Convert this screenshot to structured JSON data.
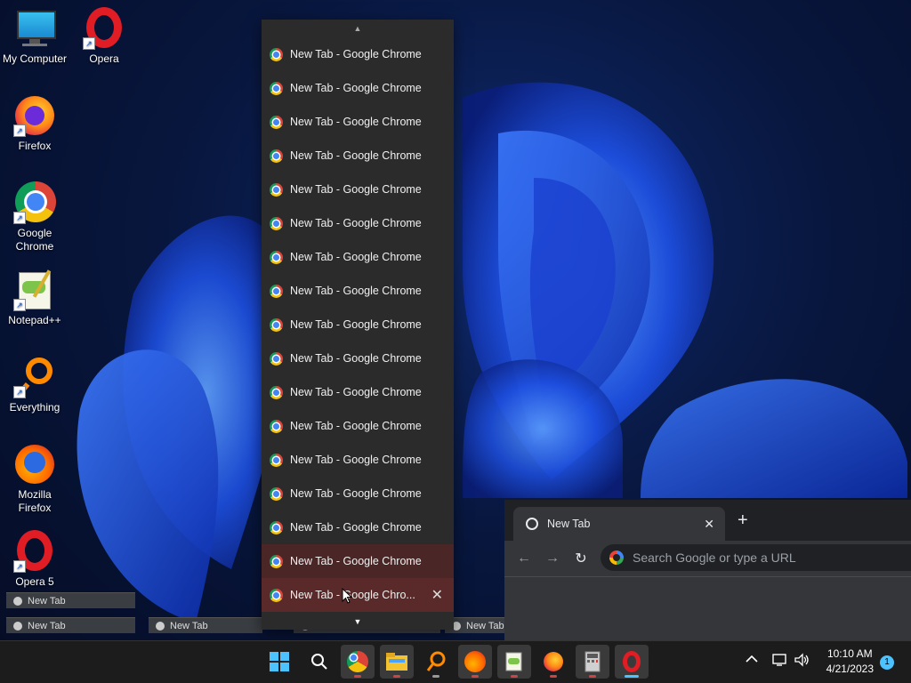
{
  "desktop": {
    "icons": [
      {
        "label": "My Computer"
      },
      {
        "label": "Opera"
      },
      {
        "label": "Firefox"
      },
      {
        "label": "Google Chrome"
      },
      {
        "label": "Notepad++"
      },
      {
        "label": "Everything"
      },
      {
        "label": "Mozilla Firefox"
      },
      {
        "label": "Opera 5"
      }
    ]
  },
  "thumbnails": [
    {
      "label": "New Tab"
    },
    {
      "label": "New Tab"
    },
    {
      "label": "New Tab"
    },
    {
      "label": "New Tab"
    },
    {
      "label": "New Tab"
    }
  ],
  "jumplist": {
    "items": [
      "New Tab - Google Chrome",
      "New Tab - Google Chrome",
      "New Tab - Google Chrome",
      "New Tab - Google Chrome",
      "New Tab - Google Chrome",
      "New Tab - Google Chrome",
      "New Tab - Google Chrome",
      "New Tab - Google Chrome",
      "New Tab - Google Chrome",
      "New Tab - Google Chrome",
      "New Tab - Google Chrome",
      "New Tab - Google Chrome",
      "New Tab - Google Chrome",
      "New Tab - Google Chrome",
      "New Tab - Google Chrome",
      "New Tab - Google Chrome"
    ],
    "hovered_item": "New Tab - Google Chro...",
    "close_glyph": "✕",
    "scroll_up_glyph": "▲",
    "scroll_down_glyph": "▼"
  },
  "chrome": {
    "tab_title": "New Tab",
    "tab_close": "✕",
    "new_tab": "+",
    "back": "←",
    "forward": "→",
    "reload": "↻",
    "omnibox_placeholder": "Search Google or type a URL"
  },
  "taskbar": {
    "time": "10:10 AM",
    "date": "4/21/2023",
    "notification_count": "1",
    "apps": [
      "windows-start",
      "search",
      "google-chrome",
      "file-explorer",
      "everything",
      "firefox",
      "notepad-plus-plus",
      "firefox-browser",
      "calculator",
      "opera"
    ]
  },
  "colors": {
    "accent": "#4cc2ff",
    "menu_bg": "#2b2b2b",
    "hover": "#5a2a2a"
  }
}
